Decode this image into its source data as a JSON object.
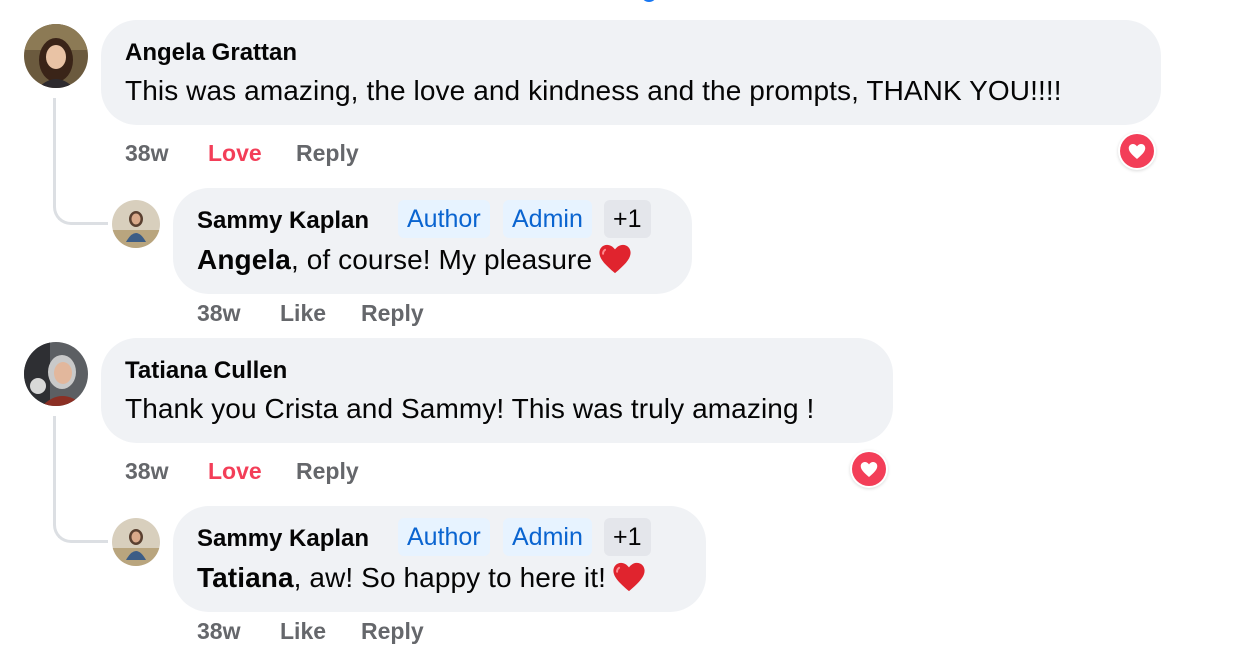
{
  "comments": [
    {
      "author": "Angela Grattan",
      "text": "This was amazing, the love and kindness and the prompts, THANK YOU!!!!",
      "time": "38w",
      "like_label": "Love",
      "reply_label": "Reply",
      "reaction_icon": "love-reaction-icon",
      "reply": {
        "author": "Sammy Kaplan",
        "badges": [
          "Author",
          "Admin",
          "+1"
        ],
        "mention": "Angela",
        "text": ", of course! My pleasure",
        "emoji": "red-heart",
        "time": "38w",
        "like_label": "Like",
        "reply_label": "Reply"
      }
    },
    {
      "author": "Tatiana Cullen",
      "text": "Thank you Crista and Sammy! This was truly amazing !",
      "time": "38w",
      "like_label": "Love",
      "reply_label": "Reply",
      "reaction_icon": "love-reaction-icon",
      "reply": {
        "author": "Sammy Kaplan",
        "badges": [
          "Author",
          "Admin",
          "+1"
        ],
        "mention": "Tatiana",
        "text": ", aw! So happy to here it!",
        "emoji": "red-heart",
        "time": "38w",
        "like_label": "Like",
        "reply_label": "Reply"
      }
    }
  ],
  "colors": {
    "love": "#f33e58",
    "badge_text": "#0a64d0",
    "badge_bg": "#e7f3ff",
    "bubble_bg": "#f0f2f5",
    "meta": "#65676b"
  }
}
